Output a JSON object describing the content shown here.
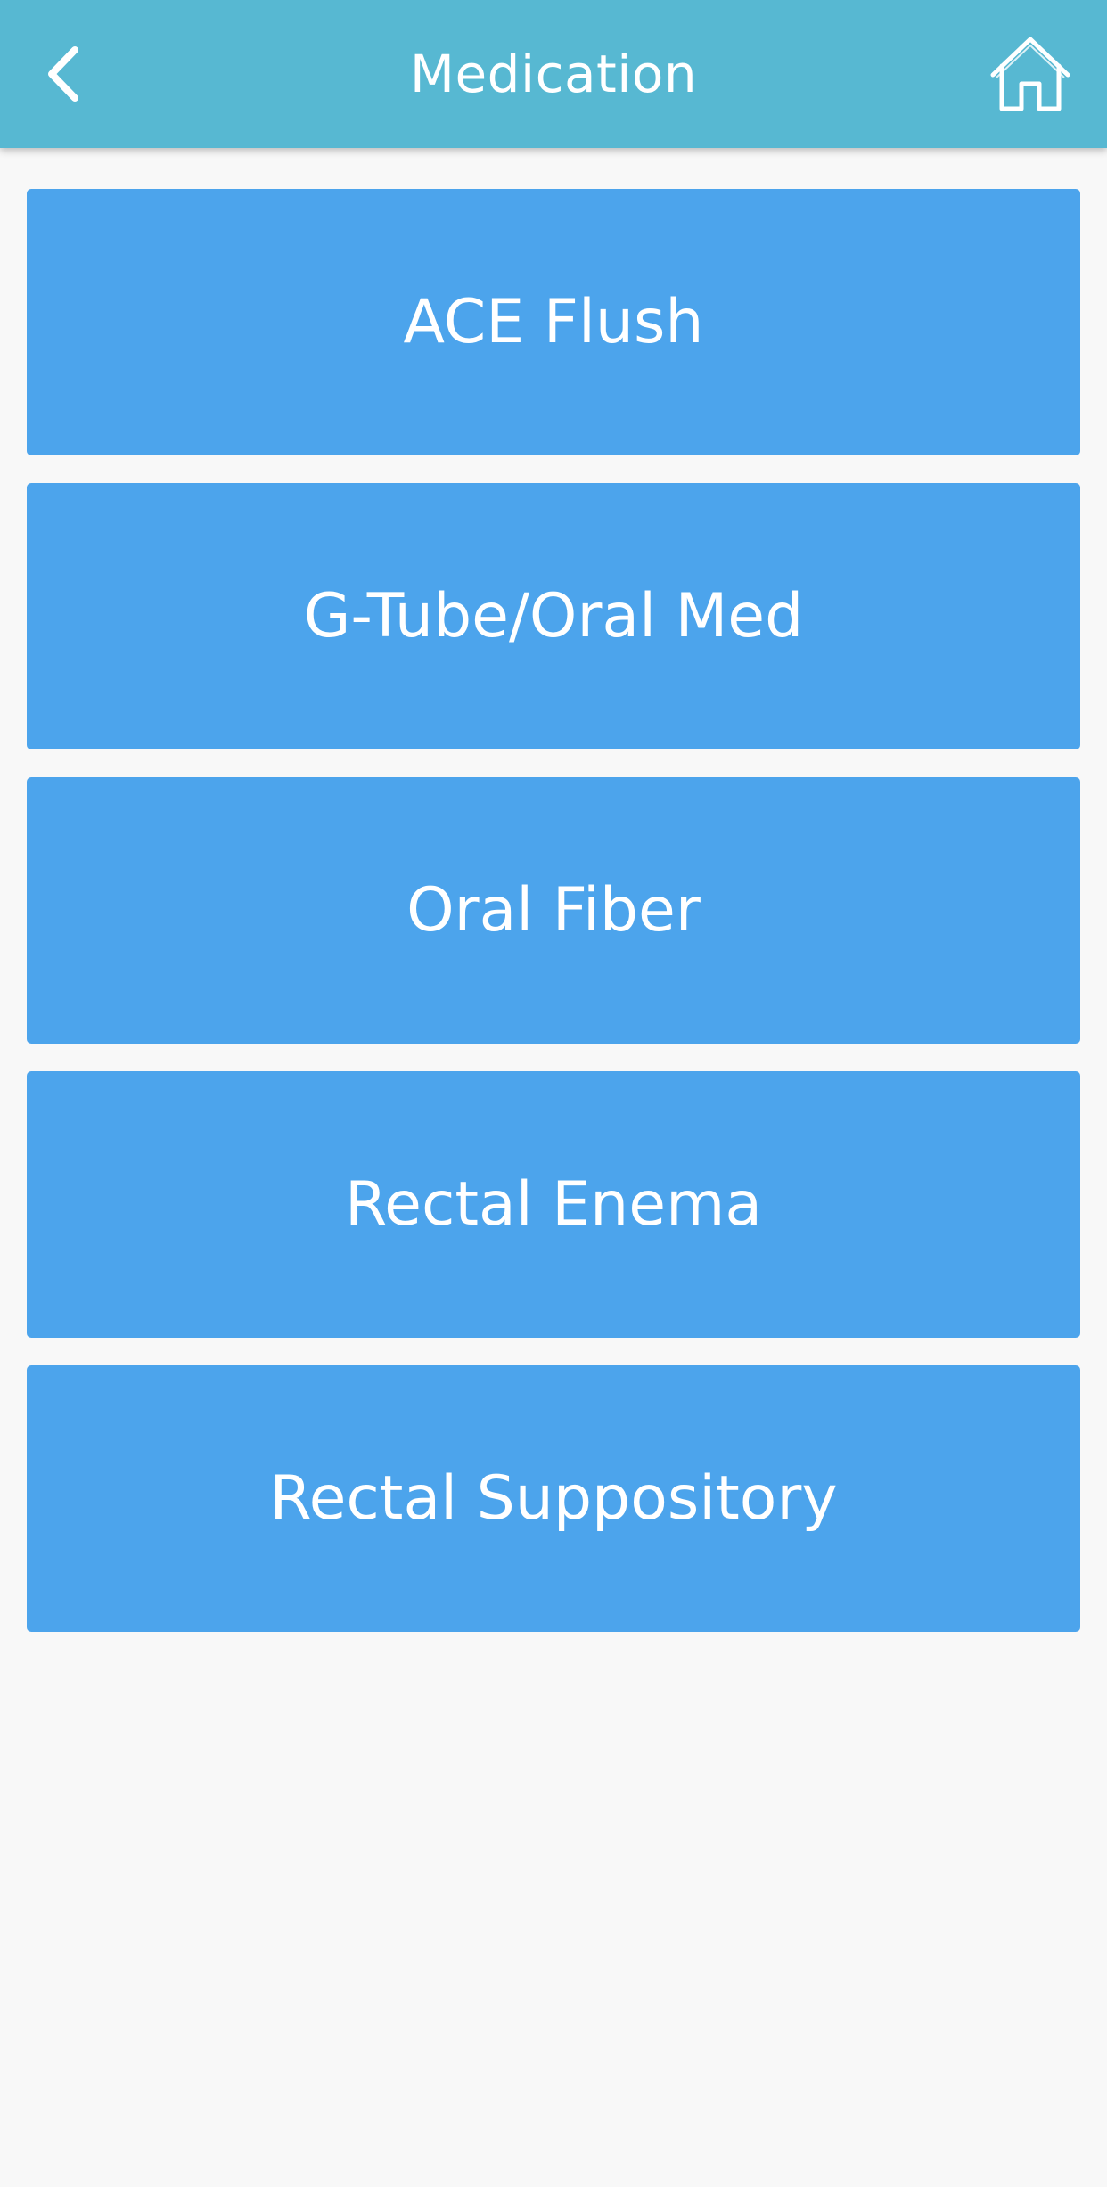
{
  "header": {
    "title": "Medication",
    "back_icon": "chevron-left-icon",
    "home_icon": "home-icon",
    "background_color": "#57b8d2"
  },
  "menu": {
    "button_color": "#4ca4ec",
    "items": [
      {
        "label": "ACE Flush"
      },
      {
        "label": "G-Tube/Oral Med"
      },
      {
        "label": "Oral Fiber"
      },
      {
        "label": "Rectal Enema"
      },
      {
        "label": "Rectal Suppository"
      }
    ]
  }
}
